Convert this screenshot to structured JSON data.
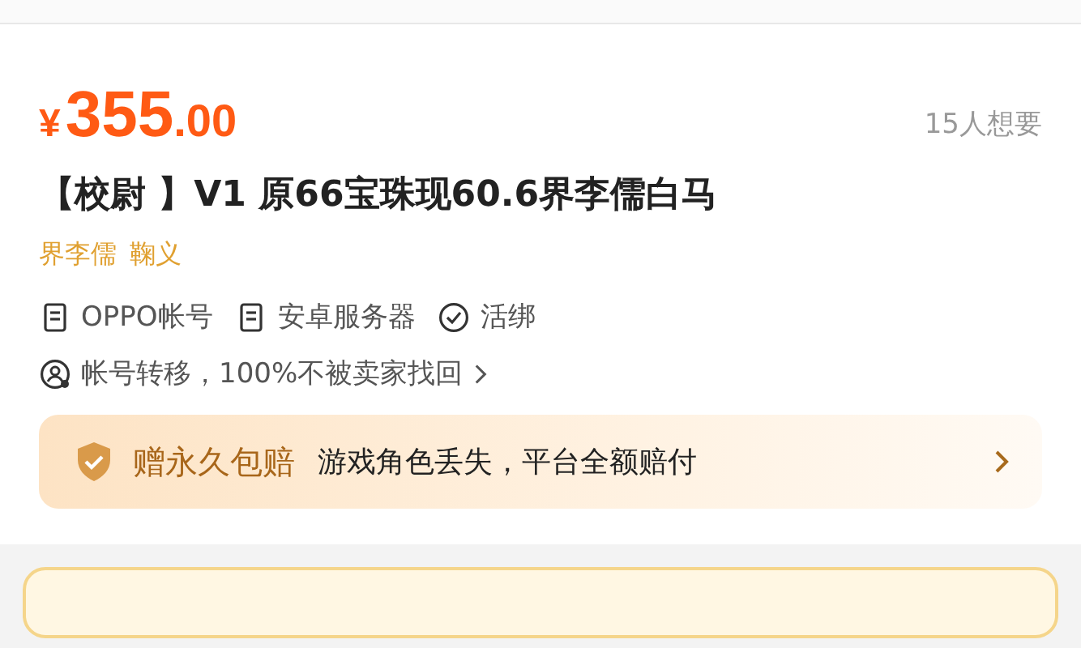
{
  "price": {
    "currency": "¥",
    "integer": "355",
    "decimal": ".00"
  },
  "wants": "15人想要",
  "title": "【校尉 】V1 原66宝珠现60.6界李儒白马",
  "tags": [
    "界李儒",
    "鞠义"
  ],
  "attributes": [
    {
      "kind": "doc",
      "label": "OPPO帐号"
    },
    {
      "kind": "doc",
      "label": "安卓服务器"
    },
    {
      "kind": "check",
      "label": "活绑"
    }
  ],
  "transfer": {
    "label": "帐号转移，100%不被卖家找回"
  },
  "guarantee": {
    "badge": "赠永久包赔",
    "text": "游戏角色丢失，平台全额赔付"
  }
}
